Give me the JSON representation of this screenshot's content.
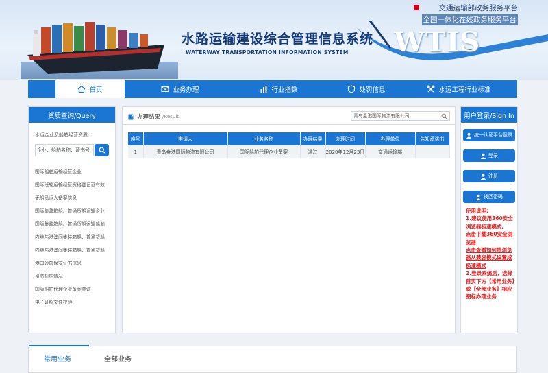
{
  "header": {
    "portal_link": "交通运输部政务服务平台",
    "national_link": "全国一体化在线政务服务平台",
    "system_title_cn": "水路运输建设综合管理信息系统",
    "system_title_en": "WATERWAY TRANSPORTATION INFORMATION SYSTEM",
    "logo_text": "WTIS"
  },
  "nav": {
    "items": [
      {
        "label": "首页",
        "icon": "home-icon",
        "active": true
      },
      {
        "label": "业务办理",
        "icon": "mail-icon"
      },
      {
        "label": "行业指数",
        "icon": "bar-chart-icon"
      },
      {
        "label": "处罚信息",
        "icon": "shield-icon"
      },
      {
        "label": "水运工程行业标准",
        "icon": "tools-icon"
      }
    ]
  },
  "left_panel": {
    "title": "资质查询/Query",
    "label": "水运企业及船舶经营资质:",
    "search_value": "企业、船舶名称、证书号（",
    "items": [
      "国际船舶运输经营企业",
      "国际班轮运输经营资格登记证有效",
      "无船承运人备案信息",
      "国际集装箱船、普通货船运输企业",
      "国际集装箱船、普通货船运输船舶",
      "内地与港澳间集装箱船、普通货船",
      "内地与港澳间集装箱船、普通货船",
      "港口设施保安证书信息",
      "引航机构情况",
      "国际船舶代理企业备案查询",
      "电子证照文件校验"
    ]
  },
  "result_panel": {
    "title": "办理结果",
    "title_sub": "/Result",
    "search_value": "青岛金港国际物流有限公司",
    "columns": [
      "序号",
      "申请人",
      "业务名称",
      "办理结果",
      "办理时间",
      "办理单位",
      "告知承诺书"
    ],
    "rows": [
      [
        "1",
        "青岛金港国际物流有限公司",
        "国际船舶代理企业备案",
        "通过",
        "2020年12月23日",
        "交通运输部",
        ""
      ]
    ]
  },
  "right_panel": {
    "title": "用户登录/Sign In",
    "buttons": {
      "unified": "统一认证平台登录",
      "login": "登录",
      "register": "注册",
      "recover": "找回密码"
    },
    "usage": {
      "heading": "使用说明:",
      "line1": "1.建议使用360安全浏览器极速模式,",
      "link1": "点击下载360安全浏览器",
      "link2": "点击查看如何将浏览器从兼容模式设置成极速模式",
      "line2": "2.登录系统后，选择首页下方【常用业务】或【全部业务】相应图标办理业务"
    }
  },
  "bottom_tabs": {
    "common": "常用业务",
    "all": "全部业务"
  },
  "colors": {
    "primary": "#1a76d2",
    "warning_text": "#e02020",
    "flag_red": "#c8001e"
  }
}
